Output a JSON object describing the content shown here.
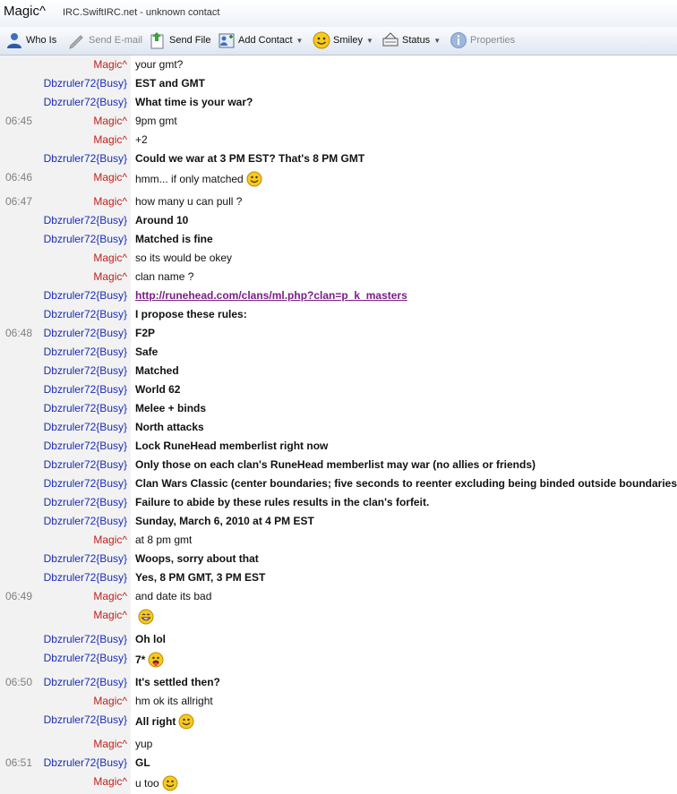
{
  "window": {
    "contact_name": "Magic^",
    "server": "IRC.SwiftIRC.net - unknown contact"
  },
  "toolbar": {
    "who_is": "Who Is",
    "send_email": "Send E-mail",
    "send_file": "Send File",
    "add_contact": "Add Contact",
    "smiley": "Smiley",
    "status": "Status",
    "properties": "Properties"
  },
  "messages": [
    {
      "time": "",
      "nick": "Magic^",
      "text": "your gmt?"
    },
    {
      "time": "",
      "nick": "Dbzruler72{Busy}",
      "text": "EST and GMT"
    },
    {
      "time": "",
      "nick": "Dbzruler72{Busy}",
      "text": "What time is your war?"
    },
    {
      "time": "06:45",
      "nick": "Magic^",
      "text": "9pm gmt"
    },
    {
      "time": "",
      "nick": "Magic^",
      "text": "+2"
    },
    {
      "time": "",
      "nick": "Dbzruler72{Busy}",
      "text": "Could we war at 3 PM EST? That's 8 PM GMT"
    },
    {
      "time": "06:46",
      "nick": "Magic^",
      "text": "hmm... if only matched",
      "emoticon": "smile"
    },
    {
      "time": "06:47",
      "nick": "Magic^",
      "text": "how many u can pull ?"
    },
    {
      "time": "",
      "nick": "Dbzruler72{Busy}",
      "text": "Around 10"
    },
    {
      "time": "",
      "nick": "Dbzruler72{Busy}",
      "text": "Matched is fine"
    },
    {
      "time": "",
      "nick": "Magic^",
      "text": "so its would be okey"
    },
    {
      "time": "",
      "nick": "Magic^",
      "text": "clan name ?"
    },
    {
      "time": "",
      "nick": "Dbzruler72{Busy}",
      "text": "http://runehead.com/clans/ml.php?clan=p_k_masters",
      "link": true
    },
    {
      "time": "",
      "nick": "Dbzruler72{Busy}",
      "text": "I propose these rules:"
    },
    {
      "time": "06:48",
      "nick": "Dbzruler72{Busy}",
      "text": "F2P"
    },
    {
      "time": "",
      "nick": "Dbzruler72{Busy}",
      "text": "Safe"
    },
    {
      "time": "",
      "nick": "Dbzruler72{Busy}",
      "text": "Matched"
    },
    {
      "time": "",
      "nick": "Dbzruler72{Busy}",
      "text": "World 62"
    },
    {
      "time": "",
      "nick": "Dbzruler72{Busy}",
      "text": "Melee + binds"
    },
    {
      "time": "",
      "nick": "Dbzruler72{Busy}",
      "text": "North attacks"
    },
    {
      "time": "",
      "nick": "Dbzruler72{Busy}",
      "text": "Lock RuneHead memberlist right now"
    },
    {
      "time": "",
      "nick": "Dbzruler72{Busy}",
      "text": "Only those on each clan's RuneHead memberlist may war (no allies or friends)"
    },
    {
      "time": "",
      "nick": "Dbzruler72{Busy}",
      "text": "Clan Wars Classic (center boundaries; five seconds to reenter excluding being binded outside boundaries)"
    },
    {
      "time": "",
      "nick": "Dbzruler72{Busy}",
      "text": "Failure to abide by these rules results in the clan's forfeit."
    },
    {
      "time": "",
      "nick": "Dbzruler72{Busy}",
      "text": "Sunday, March 6, 2010 at 4 PM EST"
    },
    {
      "time": "",
      "nick": "Magic^",
      "text": "at 8 pm gmt"
    },
    {
      "time": "",
      "nick": "Dbzruler72{Busy}",
      "text": "Woops, sorry about that"
    },
    {
      "time": "",
      "nick": "Dbzruler72{Busy}",
      "text": "Yes, 8 PM GMT, 3 PM EST"
    },
    {
      "time": "06:49",
      "nick": "Magic^",
      "text": "and date its bad"
    },
    {
      "time": "",
      "nick": "Magic^",
      "text": "",
      "emoticon": "grin"
    },
    {
      "time": "",
      "nick": "Dbzruler72{Busy}",
      "text": "Oh lol"
    },
    {
      "time": "",
      "nick": "Dbzruler72{Busy}",
      "text": "7*",
      "emoticon": "tongue"
    },
    {
      "time": "06:50",
      "nick": "Dbzruler72{Busy}",
      "text": "It's settled then?"
    },
    {
      "time": "",
      "nick": "Magic^",
      "text": "hm ok its allright"
    },
    {
      "time": "",
      "nick": "Dbzruler72{Busy}",
      "text": "All right",
      "emoticon": "smile"
    },
    {
      "time": "",
      "nick": "Magic^",
      "text": "yup"
    },
    {
      "time": "06:51",
      "nick": "Dbzruler72{Busy}",
      "text": "GL"
    },
    {
      "time": "",
      "nick": "Magic^",
      "text": "u too",
      "emoticon": "smile"
    }
  ]
}
